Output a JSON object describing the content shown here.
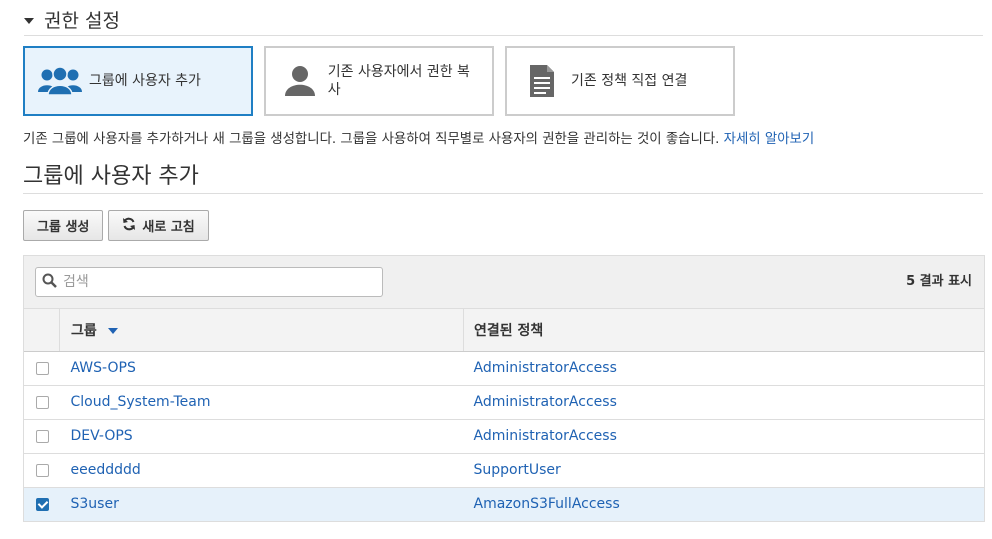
{
  "section": {
    "title": "권한 설정"
  },
  "cards": [
    {
      "label": "그룹에 사용자 추가",
      "icon": "users-icon",
      "selected": true
    },
    {
      "label": "기존 사용자에서 권한 복사",
      "icon": "user-icon",
      "selected": false
    },
    {
      "label": "기존 정책 직접 연결",
      "icon": "document-icon",
      "selected": false
    }
  ],
  "description": {
    "text": "기존 그룹에 사용자를 추가하거나 새 그룹을 생성합니다. 그룹을 사용하여 직무별로 사용자의 권한을 관리하는 것이 좋습니다.",
    "link": "자세히 알아보기"
  },
  "subsection": {
    "title": "그룹에 사용자 추가"
  },
  "toolbar": {
    "create_label": "그룹 생성",
    "refresh_label": "새로 고침"
  },
  "search": {
    "placeholder": "검색"
  },
  "results_label": "5 결과 표시",
  "table": {
    "headers": {
      "group": "그룹",
      "policy": "연결된 정책"
    },
    "rows": [
      {
        "group": "AWS-OPS",
        "policy": "AdministratorAccess",
        "checked": false
      },
      {
        "group": "Cloud_System-Team",
        "policy": "AdministratorAccess",
        "checked": false
      },
      {
        "group": "DEV-OPS",
        "policy": "AdministratorAccess",
        "checked": false
      },
      {
        "group": "eeeddddd",
        "policy": "SupportUser",
        "checked": false
      },
      {
        "group": "S3user",
        "policy": "AmazonS3FullAccess",
        "checked": true
      }
    ]
  },
  "colors": {
    "accent": "#1f7fc4",
    "link": "#1f62b3",
    "selected_row": "#e6f1fa"
  }
}
